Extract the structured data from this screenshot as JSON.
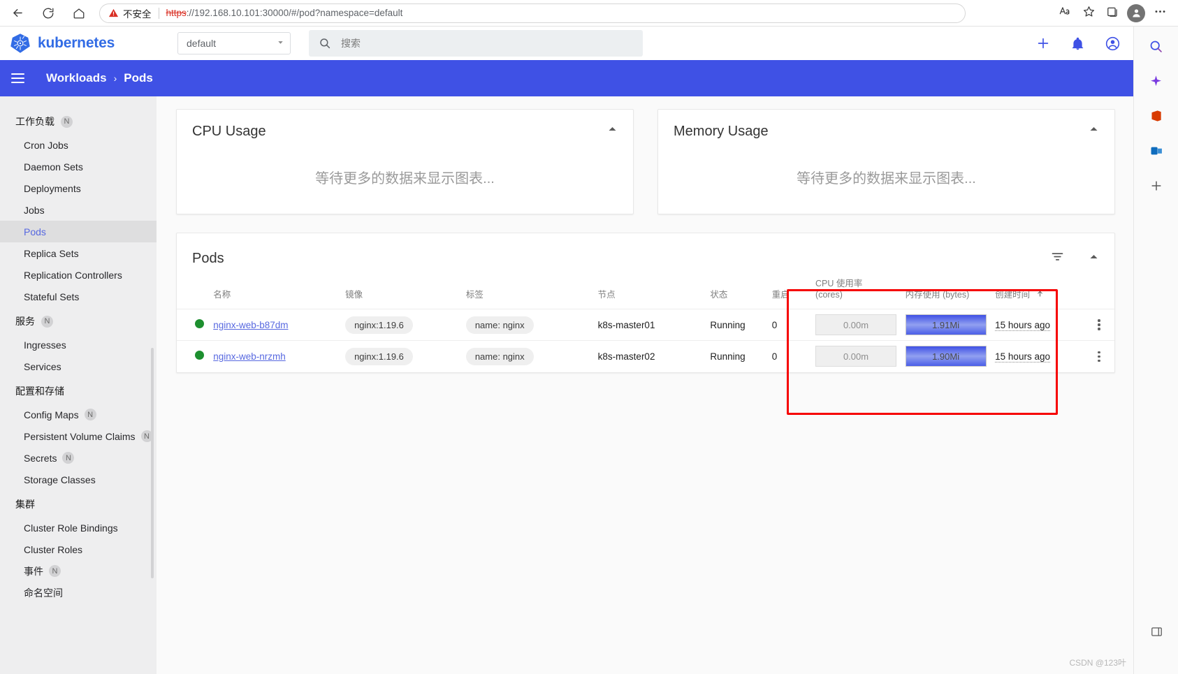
{
  "browser": {
    "back_icon": "back-arrow-icon",
    "reload_icon": "reload-icon",
    "home_icon": "home-icon",
    "security_label": "不安全",
    "url_scheme": "https",
    "url_rest": "://192.168.10.101:30000/#/pod?namespace=default",
    "url_host": "192.168.10.101",
    "read_aloud_icon": "read-aloud-icon",
    "favorite_icon": "star-icon",
    "collections_icon": "collections-icon",
    "profile_icon": "profile-icon",
    "settings_icon": "more-options-icon"
  },
  "topbar": {
    "brand": "kubernetes",
    "namespace_value": "default",
    "namespace_caret": "chevron-down-icon",
    "search_placeholder": "搜索",
    "search_icon": "search-icon",
    "create_icon": "plus-icon",
    "notifications_icon": "bell-icon",
    "account_icon": "account-circle-icon"
  },
  "breadcrumb": {
    "menu_icon": "hamburger-menu-icon",
    "parent": "Workloads",
    "separator": "›",
    "current": "Pods"
  },
  "sidebar": {
    "groups": [
      {
        "title": "工作负载",
        "badge": "N",
        "items": [
          {
            "label": "Cron Jobs",
            "badge": null,
            "active": false
          },
          {
            "label": "Daemon Sets",
            "badge": null,
            "active": false
          },
          {
            "label": "Deployments",
            "badge": null,
            "active": false
          },
          {
            "label": "Jobs",
            "badge": null,
            "active": false
          },
          {
            "label": "Pods",
            "badge": null,
            "active": true
          },
          {
            "label": "Replica Sets",
            "badge": null,
            "active": false
          },
          {
            "label": "Replication Controllers",
            "badge": null,
            "active": false
          },
          {
            "label": "Stateful Sets",
            "badge": null,
            "active": false
          }
        ]
      },
      {
        "title": "服务",
        "badge": "N",
        "items": [
          {
            "label": "Ingresses",
            "badge": null,
            "active": false
          },
          {
            "label": "Services",
            "badge": null,
            "active": false
          }
        ]
      },
      {
        "title": "配置和存储",
        "badge": null,
        "items": [
          {
            "label": "Config Maps",
            "badge": "N",
            "active": false
          },
          {
            "label": "Persistent Volume Claims",
            "badge": "N",
            "active": false
          },
          {
            "label": "Secrets",
            "badge": "N",
            "active": false
          },
          {
            "label": "Storage Classes",
            "badge": null,
            "active": false
          }
        ]
      },
      {
        "title": "集群",
        "badge": null,
        "items": [
          {
            "label": "Cluster Role Bindings",
            "badge": null,
            "active": false
          },
          {
            "label": "Cluster Roles",
            "badge": null,
            "active": false
          },
          {
            "label": "事件",
            "badge": "N",
            "active": false
          },
          {
            "label": "命名空间",
            "badge": null,
            "active": false
          }
        ]
      }
    ]
  },
  "charts": [
    {
      "title": "CPU Usage",
      "empty_message": "等待更多的数据来显示图表...",
      "collapse_icon": "chevron-up-icon"
    },
    {
      "title": "Memory Usage",
      "empty_message": "等待更多的数据来显示图表...",
      "collapse_icon": "chevron-up-icon"
    }
  ],
  "pods_card": {
    "title": "Pods",
    "filter_icon": "filter-icon",
    "collapse_icon": "chevron-up-icon",
    "columns": {
      "name": "名称",
      "image": "镜像",
      "labels": "标签",
      "node": "节点",
      "status": "状态",
      "restarts": "重启",
      "cpu_line1": "CPU 使用率",
      "cpu_line2": "(cores)",
      "memory": "内存使用 (bytes)",
      "created": "创建时间",
      "sort_icon": "sort-ascending-arrow"
    },
    "rows": [
      {
        "status_color": "#1d8f2f",
        "name": "nginx-web-b87dm",
        "image": "nginx:1.19.6",
        "label": "name: nginx",
        "node": "k8s-master01",
        "status": "Running",
        "restarts": "0",
        "cpu": "0.00m",
        "memory": "1.91Mi",
        "created": "15 hours ago",
        "menu_icon": "kebab-menu-icon"
      },
      {
        "status_color": "#1d8f2f",
        "name": "nginx-web-nrzmh",
        "image": "nginx:1.19.6",
        "label": "name: nginx",
        "node": "k8s-master02",
        "status": "Running",
        "restarts": "0",
        "cpu": "0.00m",
        "memory": "1.90Mi",
        "created": "15 hours ago",
        "menu_icon": "kebab-menu-icon"
      }
    ],
    "highlight_color": "#f60000"
  },
  "edge_rail": {
    "icons": [
      "search-icon",
      "copilot-icon",
      "office-icon",
      "outlook-icon",
      "add-icon"
    ],
    "bottom_icon": "sidebar-toggle-icon"
  },
  "watermark": "CSDN @123叶"
}
